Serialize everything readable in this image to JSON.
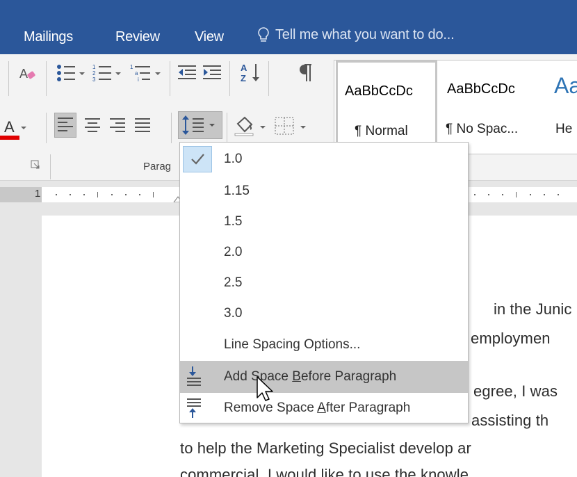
{
  "ribbon_tabs": [
    "Mailings",
    "Review",
    "View"
  ],
  "tell_me": "Tell me what you want to do...",
  "paragraph_group_label": "Parag",
  "styles": [
    {
      "sample": "AaBbCcDc",
      "name": "¶ Normal"
    },
    {
      "sample": "AaBbCcDc",
      "name": "¶ No Spac..."
    },
    {
      "sample": "Aa",
      "name": "He"
    }
  ],
  "ruler_number": "1",
  "line_spacing_menu": {
    "selected": "1.0",
    "items": [
      "1.0",
      "1.15",
      "1.5",
      "2.0",
      "2.5",
      "3.0"
    ],
    "options_label": "Line Spacing Options...",
    "add_before": {
      "pre": "Add Space ",
      "accel": "B",
      "post": "efore Paragraph"
    },
    "remove_after": {
      "pre": "Remove Space ",
      "accel": "A",
      "post": "fter Paragraph"
    }
  },
  "document_lines": [
    "in the Junic",
    "employmen",
    "egree, I was",
    "assisting th",
    "to help the Marketing Specialist develop ar",
    "commercial. I would like to use the knowle"
  ],
  "colors": {
    "ribbon_blue": "#2b579a",
    "font_color_red": "#e00000",
    "menu_hover": "#c6c6c6",
    "check_highlight": "#cde4f7"
  }
}
